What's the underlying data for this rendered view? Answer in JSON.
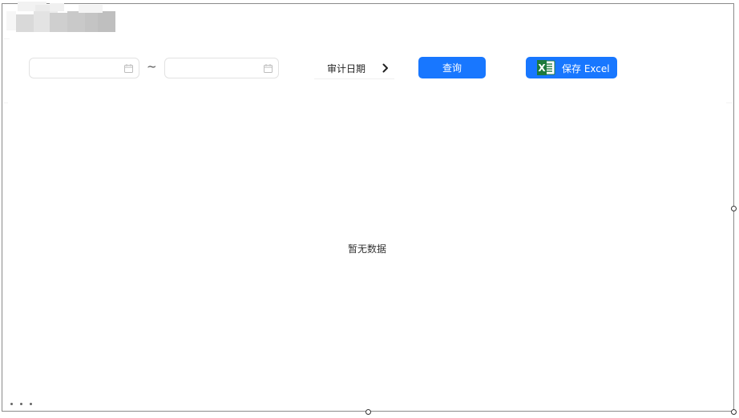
{
  "toolbar": {
    "start_date": {
      "value": "",
      "placeholder": ""
    },
    "separator": "~",
    "end_date": {
      "value": "",
      "placeholder": ""
    },
    "date_field_label": "审计日期",
    "query_label": "查询",
    "save_excel_label": "保存 Excel"
  },
  "content": {
    "empty_text": "暂无数据"
  },
  "colors": {
    "primary": "#1877ff",
    "excel_green": "#1d7a3c"
  },
  "icons": {
    "calendar": "calendar-icon",
    "chevron": "chevron-right-icon",
    "excel": "excel-icon"
  }
}
